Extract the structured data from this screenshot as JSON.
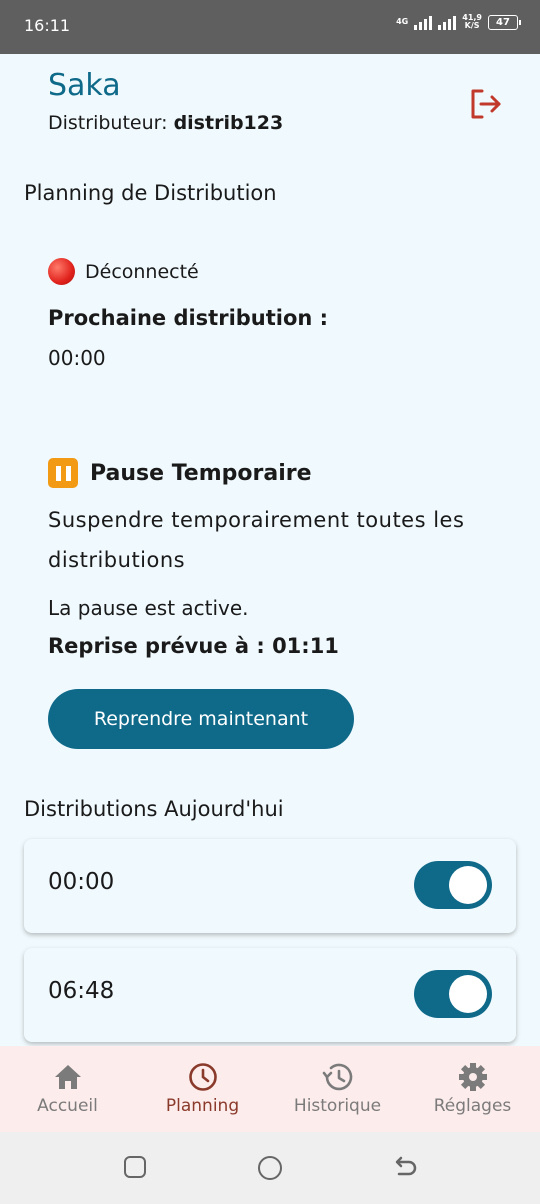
{
  "status_bar": {
    "time": "16:11",
    "network": "4G",
    "speed_value": "41,9",
    "speed_unit": "K/S",
    "battery": "47"
  },
  "header": {
    "title": "Saka",
    "subtitle_label": "Distributeur:",
    "subtitle_value": "distrib123"
  },
  "planning": {
    "title": "Planning de Distribution",
    "connection_status": "Déconnecté",
    "next_label": "Prochaine distribution :",
    "next_time": "00:00"
  },
  "pause": {
    "title": "Pause Temporaire",
    "description": "Suspendre temporairement toutes les distributions",
    "active_text": "La pause est active.",
    "resume_text": "Reprise prévue à : 01:11",
    "resume_button": "Reprendre maintenant"
  },
  "today": {
    "title": "Distributions Aujourd'hui",
    "items": [
      {
        "time": "00:00",
        "enabled": true
      },
      {
        "time": "06:48",
        "enabled": true
      }
    ]
  },
  "nav": {
    "items": [
      {
        "label": "Accueil",
        "icon": "home-icon"
      },
      {
        "label": "Planning",
        "icon": "clock-icon",
        "active": true
      },
      {
        "label": "Historique",
        "icon": "history-icon"
      },
      {
        "label": "Réglages",
        "icon": "gear-icon"
      }
    ]
  },
  "colors": {
    "accent": "#0f6a8a",
    "background": "#f0f9fd",
    "nav_active": "#8a3a2a",
    "logout": "#c0392b"
  }
}
